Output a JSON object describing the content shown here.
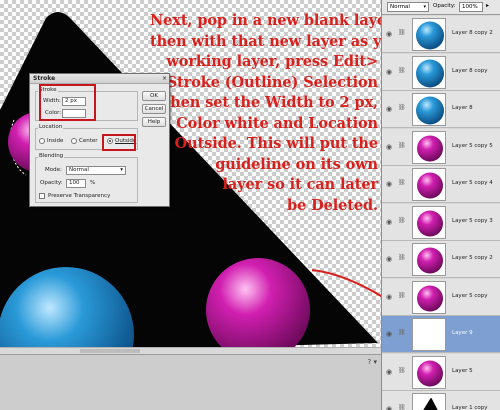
{
  "instructions": {
    "lines": [
      "Next, pop in a new blank layer",
      "then with that new layer as your",
      "working layer, press Edit>",
      "Stroke (Outline) Selection",
      "then set the Width to 2 px,",
      "Color white and Location",
      "Outside. This will put the",
      "guideline on its own",
      "layer so it can later",
      "be Deleted."
    ]
  },
  "dialog": {
    "title": "Stroke",
    "close_glyph": "×",
    "stroke_group": "Stroke",
    "width_label": "Width:",
    "width_value": "2 px",
    "color_label": "Color:",
    "location_group": "Location",
    "loc_inside": "Inside",
    "loc_center": "Center",
    "loc_outside": "Outside",
    "blending_group": "Blending",
    "mode_label": "Mode:",
    "mode_value": "Normal",
    "opacity_label": "Opacity:",
    "opacity_value": "100",
    "opacity_unit": "%",
    "preserve_label": "Preserve Transparency",
    "ok": "OK",
    "cancel": "Cancel",
    "help": "Help",
    "selected_location": "Outside"
  },
  "layers_panel": {
    "blend_mode": "Normal",
    "opacity_label": "Opacity:",
    "opacity_value": "100%",
    "layers": [
      {
        "name": "Layer 8 copy 2",
        "thumb": "blue"
      },
      {
        "name": "Layer 8 copy",
        "thumb": "blue"
      },
      {
        "name": "Layer 8",
        "thumb": "blue"
      },
      {
        "name": "Layer 5 copy 5",
        "thumb": "magenta"
      },
      {
        "name": "Layer 5 copy 4",
        "thumb": "magenta"
      },
      {
        "name": "Layer 5 copy 3",
        "thumb": "magenta"
      },
      {
        "name": "Layer 5 copy 2",
        "thumb": "magenta"
      },
      {
        "name": "Layer 5 copy",
        "thumb": "magenta"
      },
      {
        "name": "Layer 9",
        "thumb": "empty",
        "active": true
      },
      {
        "name": "Layer 5",
        "thumb": "magenta"
      },
      {
        "name": "Layer 1 copy",
        "thumb": "shape"
      }
    ]
  },
  "colors": {
    "annotation_red": "#d8201c",
    "highlight_box": "#c4161c",
    "active_layer": "#7d9fd1",
    "blue_ball": "#1e88c8",
    "magenta_ball": "#d11fb0"
  },
  "icons": {
    "visibility": "eye-icon",
    "link": "link-icon",
    "bottom_bar": [
      "help-icon",
      "dropdown-icon"
    ]
  }
}
